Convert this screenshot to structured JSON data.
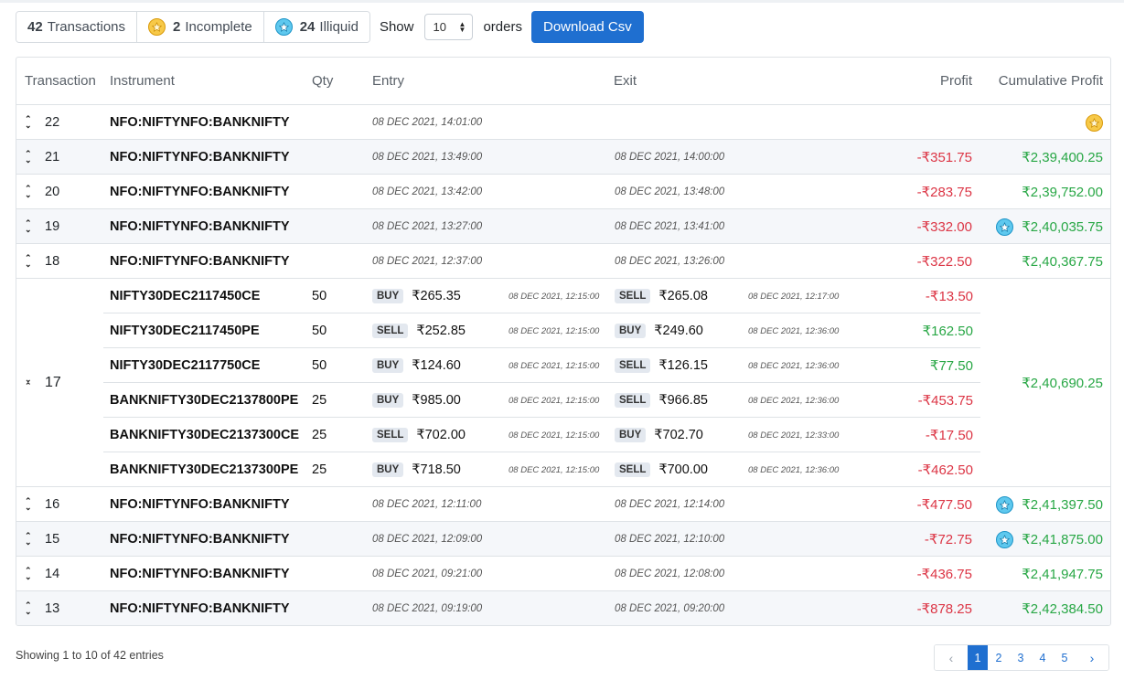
{
  "toolbar": {
    "transactions_count": "42",
    "transactions_label": "Transactions",
    "incomplete_count": "2",
    "incomplete_label": "Incomplete",
    "illiquid_count": "24",
    "illiquid_label": "Illiquid",
    "show_label": "Show",
    "page_size": "10",
    "orders_label": "orders",
    "download_label": "Download Csv"
  },
  "colors": {
    "accent": "#1f6fd0",
    "loss": "#dc3545",
    "gain": "#28a745",
    "incomplete_icon": "#f7c948",
    "illiquid_icon": "#5ec8ee"
  },
  "table": {
    "headers": {
      "transaction": "Transaction",
      "instrument": "Instrument",
      "qty": "Qty",
      "entry": "Entry",
      "exit": "Exit",
      "profit": "Profit",
      "cumulative": "Cumulative Profit"
    },
    "rows": [
      {
        "id": "22",
        "instrument": "NFO:NIFTYNFO:BANKNIFTY",
        "entry": "08 DEC 2021, 14:01:00",
        "exit": "",
        "profit": "",
        "cumulative": "",
        "icon": "star-gold-icon"
      },
      {
        "id": "21",
        "instrument": "NFO:NIFTYNFO:BANKNIFTY",
        "entry": "08 DEC 2021, 13:49:00",
        "exit": "08 DEC 2021, 14:00:00",
        "profit": "-₹351.75",
        "cumulative": "₹2,39,400.25",
        "icon": ""
      },
      {
        "id": "20",
        "instrument": "NFO:NIFTYNFO:BANKNIFTY",
        "entry": "08 DEC 2021, 13:42:00",
        "exit": "08 DEC 2021, 13:48:00",
        "profit": "-₹283.75",
        "cumulative": "₹2,39,752.00",
        "icon": ""
      },
      {
        "id": "19",
        "instrument": "NFO:NIFTYNFO:BANKNIFTY",
        "entry": "08 DEC 2021, 13:27:00",
        "exit": "08 DEC 2021, 13:41:00",
        "profit": "-₹332.00",
        "cumulative": "₹2,40,035.75",
        "icon": "star-blue-icon"
      },
      {
        "id": "18",
        "instrument": "NFO:NIFTYNFO:BANKNIFTY",
        "entry": "08 DEC 2021, 12:37:00",
        "exit": "08 DEC 2021, 13:26:00",
        "profit": "-₹322.50",
        "cumulative": "₹2,40,367.75",
        "icon": ""
      }
    ],
    "group": {
      "id": "17",
      "cumulative": "₹2,40,690.25",
      "legs": [
        {
          "instrument": "NIFTY30DEC2117450CE",
          "qty": "50",
          "entry_side": "BUY",
          "entry_price": "₹265.35",
          "entry_time": "08 DEC 2021, 12:15:00",
          "exit_side": "SELL",
          "exit_price": "₹265.08",
          "exit_time": "08 DEC 2021, 12:17:00",
          "profit": "-₹13.50"
        },
        {
          "instrument": "NIFTY30DEC2117450PE",
          "qty": "50",
          "entry_side": "SELL",
          "entry_price": "₹252.85",
          "entry_time": "08 DEC 2021, 12:15:00",
          "exit_side": "BUY",
          "exit_price": "₹249.60",
          "exit_time": "08 DEC 2021, 12:36:00",
          "profit": "₹162.50"
        },
        {
          "instrument": "NIFTY30DEC2117750CE",
          "qty": "50",
          "entry_side": "BUY",
          "entry_price": "₹124.60",
          "entry_time": "08 DEC 2021, 12:15:00",
          "exit_side": "SELL",
          "exit_price": "₹126.15",
          "exit_time": "08 DEC 2021, 12:36:00",
          "profit": "₹77.50"
        },
        {
          "instrument": "BANKNIFTY30DEC2137800PE",
          "qty": "25",
          "entry_side": "BUY",
          "entry_price": "₹985.00",
          "entry_time": "08 DEC 2021, 12:15:00",
          "exit_side": "SELL",
          "exit_price": "₹966.85",
          "exit_time": "08 DEC 2021, 12:36:00",
          "profit": "-₹453.75"
        },
        {
          "instrument": "BANKNIFTY30DEC2137300CE",
          "qty": "25",
          "entry_side": "SELL",
          "entry_price": "₹702.00",
          "entry_time": "08 DEC 2021, 12:15:00",
          "exit_side": "BUY",
          "exit_price": "₹702.70",
          "exit_time": "08 DEC 2021, 12:33:00",
          "profit": "-₹17.50"
        },
        {
          "instrument": "BANKNIFTY30DEC2137300PE",
          "qty": "25",
          "entry_side": "BUY",
          "entry_price": "₹718.50",
          "entry_time": "08 DEC 2021, 12:15:00",
          "exit_side": "SELL",
          "exit_price": "₹700.00",
          "exit_time": "08 DEC 2021, 12:36:00",
          "profit": "-₹462.50"
        }
      ]
    },
    "rows_after": [
      {
        "id": "16",
        "instrument": "NFO:NIFTYNFO:BANKNIFTY",
        "entry": "08 DEC 2021, 12:11:00",
        "exit": "08 DEC 2021, 12:14:00",
        "profit": "-₹477.50",
        "cumulative": "₹2,41,397.50",
        "icon": "star-blue-icon"
      },
      {
        "id": "15",
        "instrument": "NFO:NIFTYNFO:BANKNIFTY",
        "entry": "08 DEC 2021, 12:09:00",
        "exit": "08 DEC 2021, 12:10:00",
        "profit": "-₹72.75",
        "cumulative": "₹2,41,875.00",
        "icon": "star-blue-icon"
      },
      {
        "id": "14",
        "instrument": "NFO:NIFTYNFO:BANKNIFTY",
        "entry": "08 DEC 2021, 09:21:00",
        "exit": "08 DEC 2021, 12:08:00",
        "profit": "-₹436.75",
        "cumulative": "₹2,41,947.75",
        "icon": ""
      },
      {
        "id": "13",
        "instrument": "NFO:NIFTYNFO:BANKNIFTY",
        "entry": "08 DEC 2021, 09:19:00",
        "exit": "08 DEC 2021, 09:20:00",
        "profit": "-₹878.25",
        "cumulative": "₹2,42,384.50",
        "icon": ""
      }
    ]
  },
  "footer": {
    "info": "Showing 1 to 10 of 42 entries",
    "pages": [
      "1",
      "2",
      "3",
      "4",
      "5"
    ],
    "prev": "‹",
    "next": "›"
  }
}
